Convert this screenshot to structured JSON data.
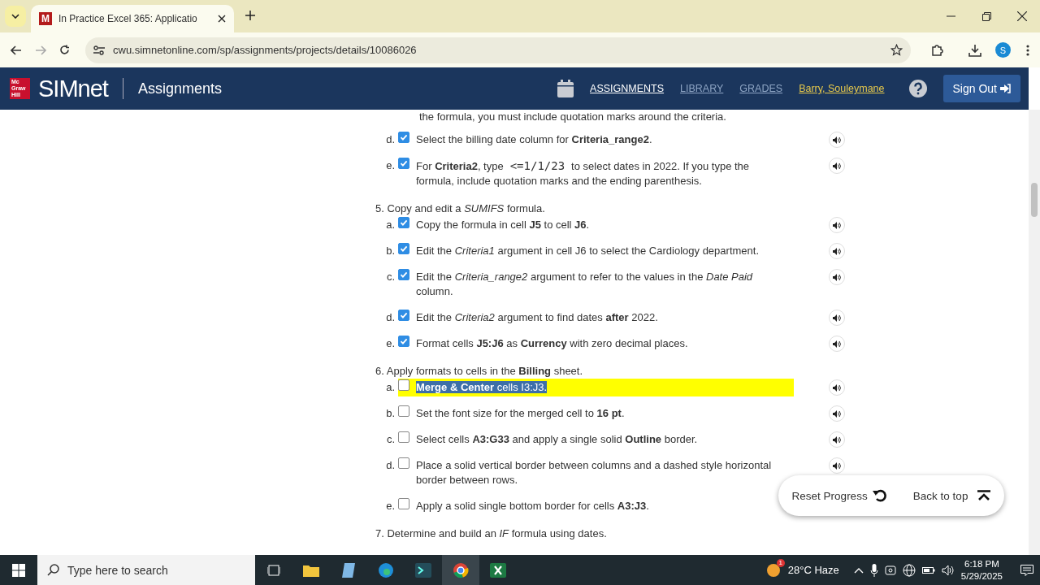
{
  "browser": {
    "tab": {
      "favicon": "M",
      "title": "In Practice Excel 365: Applicatio"
    },
    "url": "cwu.simnetonline.com/sp/assignments/projects/details/10086026",
    "profile": "S"
  },
  "header": {
    "publisher_logo": [
      "Mc",
      "Graw",
      "Hill"
    ],
    "brand": "SIMnet",
    "section": "Assignments",
    "nav": [
      {
        "label": "ASSIGNMENTS",
        "selected": true
      },
      {
        "label": "LIBRARY",
        "selected": false
      },
      {
        "label": "GRADES",
        "selected": false
      }
    ],
    "user": "Barry, Souleymane",
    "sign_out": "Sign Out"
  },
  "content": {
    "partial_line": "the formula, you must include quotation marks around the criteria.",
    "steps": [
      {
        "items": [
          {
            "letter": "d.",
            "checked": true,
            "highlighted": false,
            "text": "Select the billing date column for **Criteria_range2**."
          },
          {
            "letter": "e.",
            "checked": true,
            "highlighted": false,
            "text": "For **Criteria2**, type",
            "code": "<=1/1/23",
            "text_after": "to select dates in 2022. If you type the formula, include quotation marks and the ending parenthesis."
          }
        ]
      },
      {
        "number": "5.",
        "text": "Copy and edit a *SUMIFS* formula.",
        "items": [
          {
            "letter": "a.",
            "checked": true,
            "highlighted": false,
            "text": "Copy the formula in cell **J5** to cell **J6**."
          },
          {
            "letter": "b.",
            "checked": true,
            "highlighted": false,
            "text": "Edit the *Criteria1* argument in cell J6 to select the Cardiology department."
          },
          {
            "letter": "c.",
            "checked": true,
            "highlighted": false,
            "text": "Edit the *Criteria_range2* argument to refer to the values in the *Date Paid* column."
          },
          {
            "letter": "d.",
            "checked": true,
            "highlighted": false,
            "text": "Edit the *Criteria2* argument to find dates **after** 2022."
          },
          {
            "letter": "e.",
            "checked": true,
            "highlighted": false,
            "text": "Format cells **J5:J6** as **Currency** with zero decimal places."
          }
        ]
      },
      {
        "number": "6.",
        "text": "Apply formats to cells in the **Billing** sheet.",
        "items": [
          {
            "letter": "a.",
            "checked": false,
            "highlighted": true,
            "text": "**Merge & Center** cells I3:J3."
          },
          {
            "letter": "b.",
            "checked": false,
            "highlighted": false,
            "text": "Set the font size for the merged cell to **16 pt**."
          },
          {
            "letter": "c.",
            "checked": false,
            "highlighted": false,
            "text": "Select cells **A3:G33** and apply a single solid **Outline** border."
          },
          {
            "letter": "d.",
            "checked": false,
            "highlighted": false,
            "text": "Place a solid vertical border between columns and a dashed style horizontal border between rows."
          },
          {
            "letter": "e.",
            "checked": false,
            "highlighted": false,
            "text": "Apply a solid single bottom border for cells **A3:J3**."
          }
        ]
      },
      {
        "number": "7.",
        "text": "Determine and build an *IF* formula using dates."
      }
    ],
    "floating": {
      "reset": "Reset Progress",
      "back": "Back to top"
    }
  },
  "taskbar": {
    "search_placeholder": "Type here to search",
    "weather_badge": "1",
    "weather": "28°C Haze",
    "time": "6:18 PM",
    "date": "5/29/2025"
  }
}
